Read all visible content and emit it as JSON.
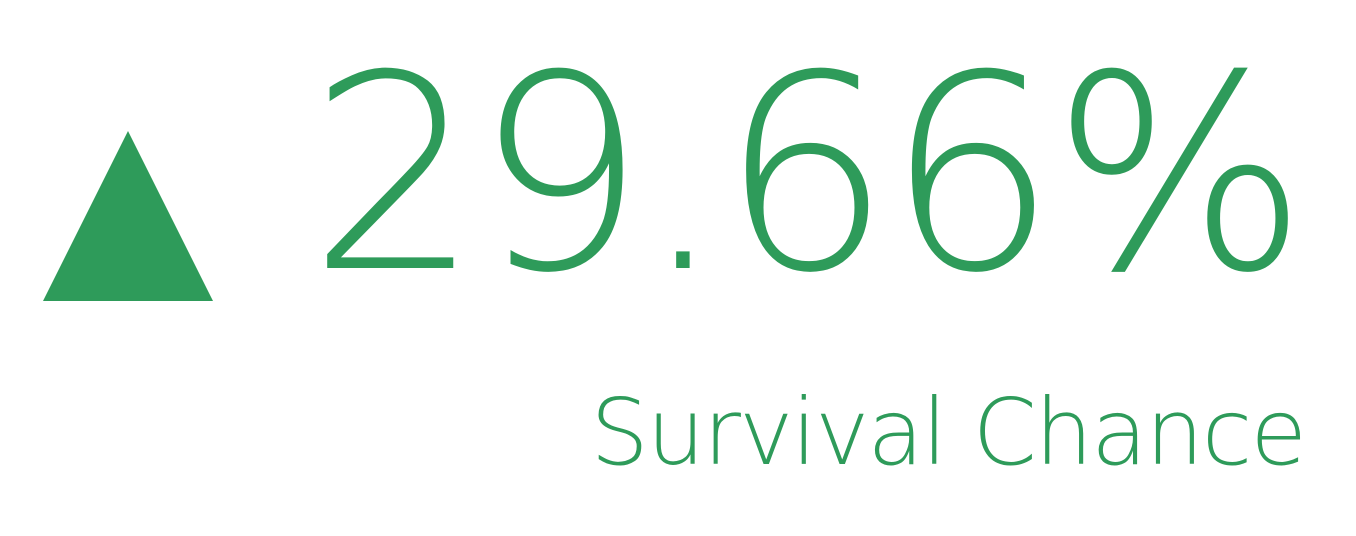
{
  "kpi": {
    "value": "29.66%",
    "label": "Survival Chance",
    "trend_icon": "triangle-up-icon"
  },
  "colors": {
    "accent": "#2e9b5a",
    "background": "#ffffff"
  }
}
